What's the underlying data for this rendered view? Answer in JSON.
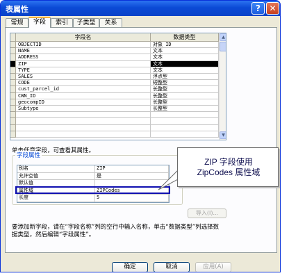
{
  "window": {
    "title": "表属性",
    "help_glyph": "?",
    "close_glyph": "✕"
  },
  "tabs": [
    "常规",
    "字段",
    "索引",
    "子类型",
    "关系"
  ],
  "active_tab": "字段",
  "fields_grid": {
    "headers": [
      "字段名",
      "数据类型"
    ],
    "rows": [
      {
        "name": "OBJECTID",
        "type": "对象 ID"
      },
      {
        "name": "NAME",
        "type": "文本"
      },
      {
        "name": "ADDRESS",
        "type": "文本"
      },
      {
        "name": "ZIP",
        "type": "文本",
        "selected": true
      },
      {
        "name": "TYPE",
        "type": "文本"
      },
      {
        "name": "SALES",
        "type": "浮点型"
      },
      {
        "name": "CODE",
        "type": "短整型"
      },
      {
        "name": "cust_parcel_id",
        "type": "长整型"
      },
      {
        "name": "CWN_ID",
        "type": "长整型"
      },
      {
        "name": "geocompID",
        "type": "长整型"
      },
      {
        "name": "Subtype",
        "type": "长整型"
      },
      {
        "name": "",
        "type": ""
      },
      {
        "name": "",
        "type": ""
      },
      {
        "name": "",
        "type": ""
      },
      {
        "name": "",
        "type": ""
      }
    ],
    "scroll_up": "▲",
    "scroll_down": "▼"
  },
  "hint": "单击任意字段，可查看其属性。",
  "field_properties": {
    "title": "字段属性",
    "rows": [
      {
        "label": "别名",
        "value": "ZIP"
      },
      {
        "label": "允许空值",
        "value": "是"
      },
      {
        "label": "默认值",
        "value": ""
      },
      {
        "label": "属性域",
        "value": "ZIPCodes"
      },
      {
        "label": "长度",
        "value": "5"
      }
    ]
  },
  "import_button": "导入(I)...",
  "note": "要添加新字段，请在“字段名称”列的空行中输入名称，单击“数据类型”列选择数据类型，然后编辑“字段属性”。",
  "buttons": {
    "ok": "确定",
    "cancel": "取消",
    "apply": "应用(A)"
  },
  "callout": {
    "line1": "ZIP 字段使用",
    "line2": "ZipCodes 属性域"
  },
  "colors": {
    "title_bar": "#0b4ad6",
    "highlight_border": "#1010b0",
    "tab_accent": "#f5b33b"
  }
}
